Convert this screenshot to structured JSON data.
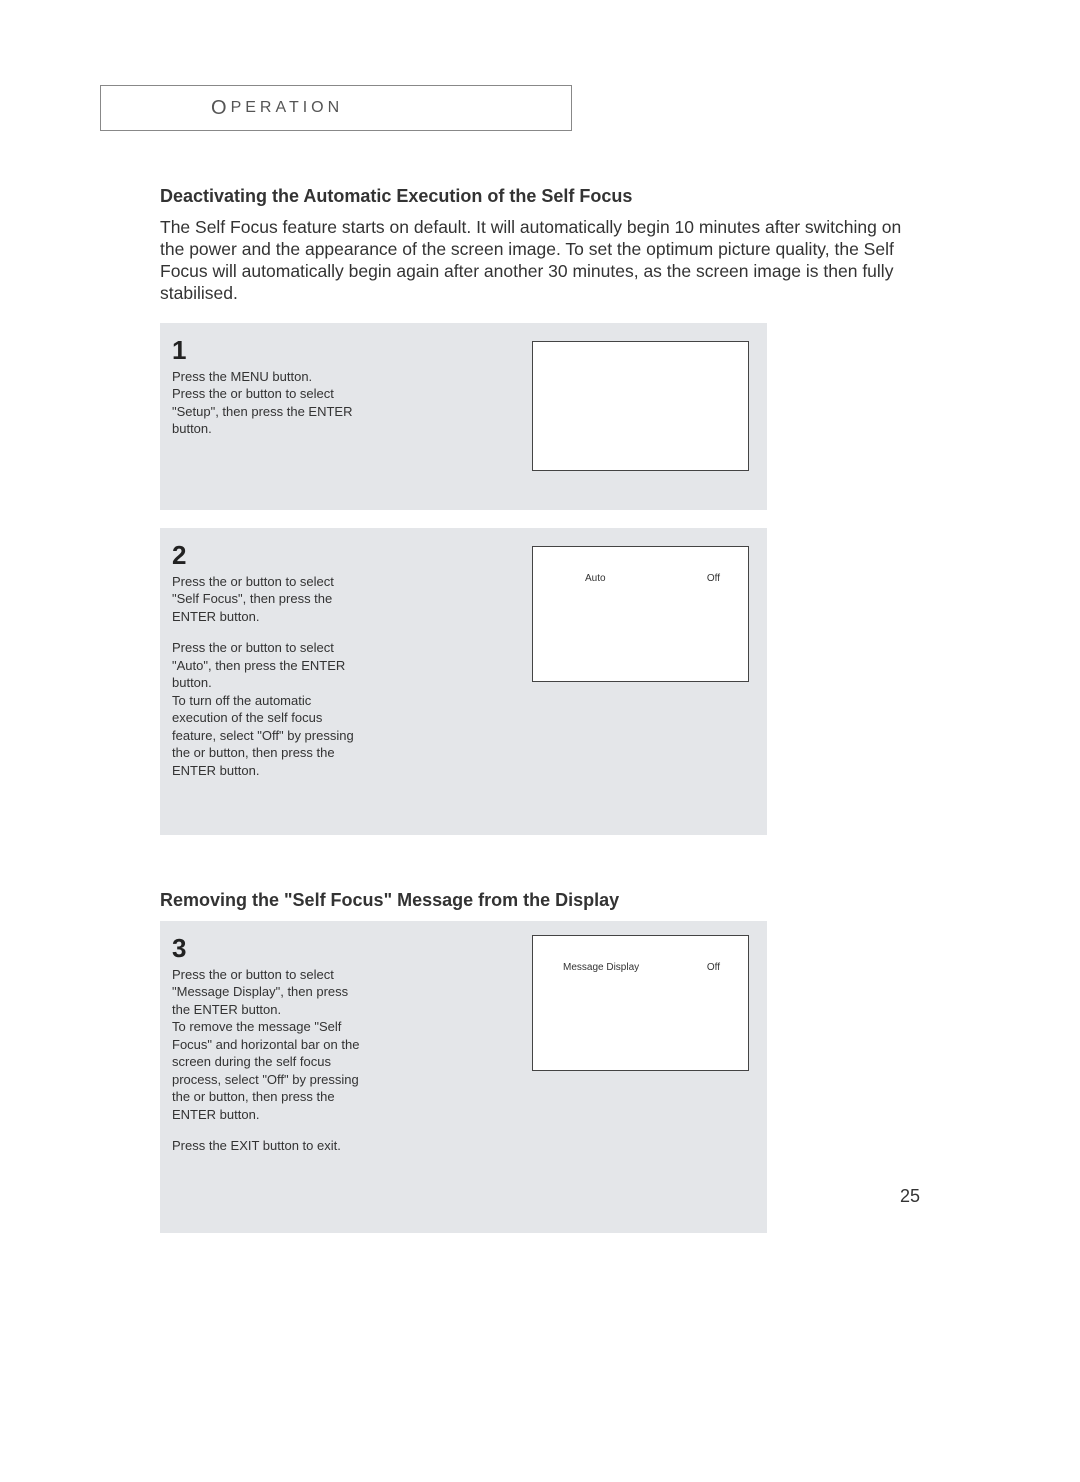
{
  "header": {
    "cap": "O",
    "rest": "PERATION"
  },
  "section1": {
    "title": "Deactivating the Automatic Execution of the Self Focus",
    "intro": "The  Self Focus  feature starts on default. It will automatically begin 10 minutes after switching on the power and the appearance of the screen image. To set the optimum picture quality, the  Self Focus  will automatically begin again after another 30 minutes, as the screen image is then fully stabilised."
  },
  "step1": {
    "num": "1",
    "line1": "Press the MENU button.",
    "line2": "Press the     or     button to select \"Setup\", then press the ENTER button."
  },
  "step2": {
    "num": "2",
    "p1": "Press the     or     button to select \"Self Focus\", then press the ENTER button.",
    "p2": "Press the     or     button to select \"Auto\", then press the ENTER button.",
    "p3": "To turn off the automatic execution of the self focus feature, select \"Off\" by pressing the     or     button, then press the ENTER button.",
    "osd_left": "Auto",
    "osd_right": "Off"
  },
  "section2": {
    "title": "Removing the \"Self Focus\" Message from the Display"
  },
  "step3": {
    "num": "3",
    "p1": "Press the     or     button to select \"Message Display\", then press the ENTER button.",
    "p2": "To remove the message \"Self Focus\" and horizontal bar on the screen during the self focus process, select \"Off\" by pressing the     or     button, then press the ENTER button.",
    "p3": "Press the EXIT button to exit.",
    "osd_left": "Message Display",
    "osd_right": "Off"
  },
  "page_number": "25"
}
